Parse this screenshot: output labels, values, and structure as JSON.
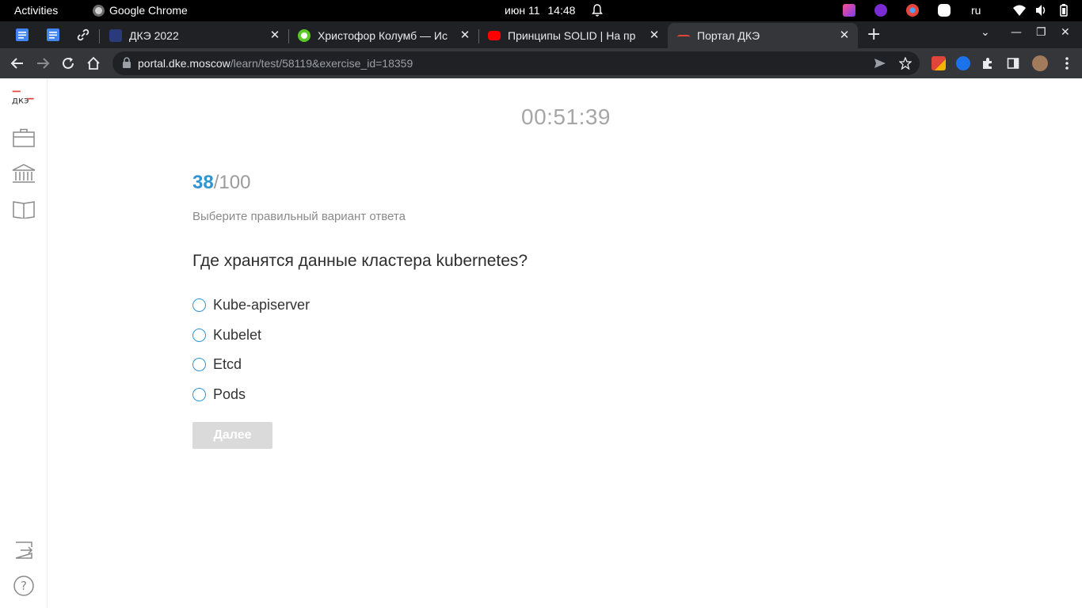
{
  "topbar": {
    "activities": "Activities",
    "app_name": "Google Chrome",
    "date": "июн 11",
    "time": "14:48",
    "lang": "ru"
  },
  "tabs": [
    {
      "title": "ДКЭ 2022",
      "favicon": "dke-favicon"
    },
    {
      "title": "Христофор Колумб — Ис",
      "favicon": "green-circle-favicon"
    },
    {
      "title": "Принципы SOLID | На пр",
      "favicon": "youtube-favicon"
    },
    {
      "title": "Портал ДКЭ",
      "favicon": "dke-portal-favicon",
      "active": true
    }
  ],
  "pinned_tabs": [
    "google-docs-icon",
    "google-docs-icon",
    "link-icon"
  ],
  "address_bar": {
    "host": "portal.dke.moscow",
    "path": "/learn/test/58119&exercise_id=18359"
  },
  "sidebar": {
    "logo_text": "дкэ",
    "items": [
      "briefcase-icon",
      "institution-icon",
      "book-icon"
    ],
    "bottom": [
      "logout-icon",
      "help-icon"
    ],
    "help_label": "?"
  },
  "test": {
    "timer": "00:51:39",
    "current": "38",
    "total": "/100",
    "instruction": "Выберите правильный вариант ответа",
    "question": "Где хранятся данные кластера kubernetes?",
    "options": [
      "Kube-apiserver",
      "Kubelet",
      "Etcd",
      "Pods"
    ],
    "next_label": "Далее"
  },
  "colors": {
    "accent": "#2f94d2",
    "button_disabled": "#dadada"
  }
}
